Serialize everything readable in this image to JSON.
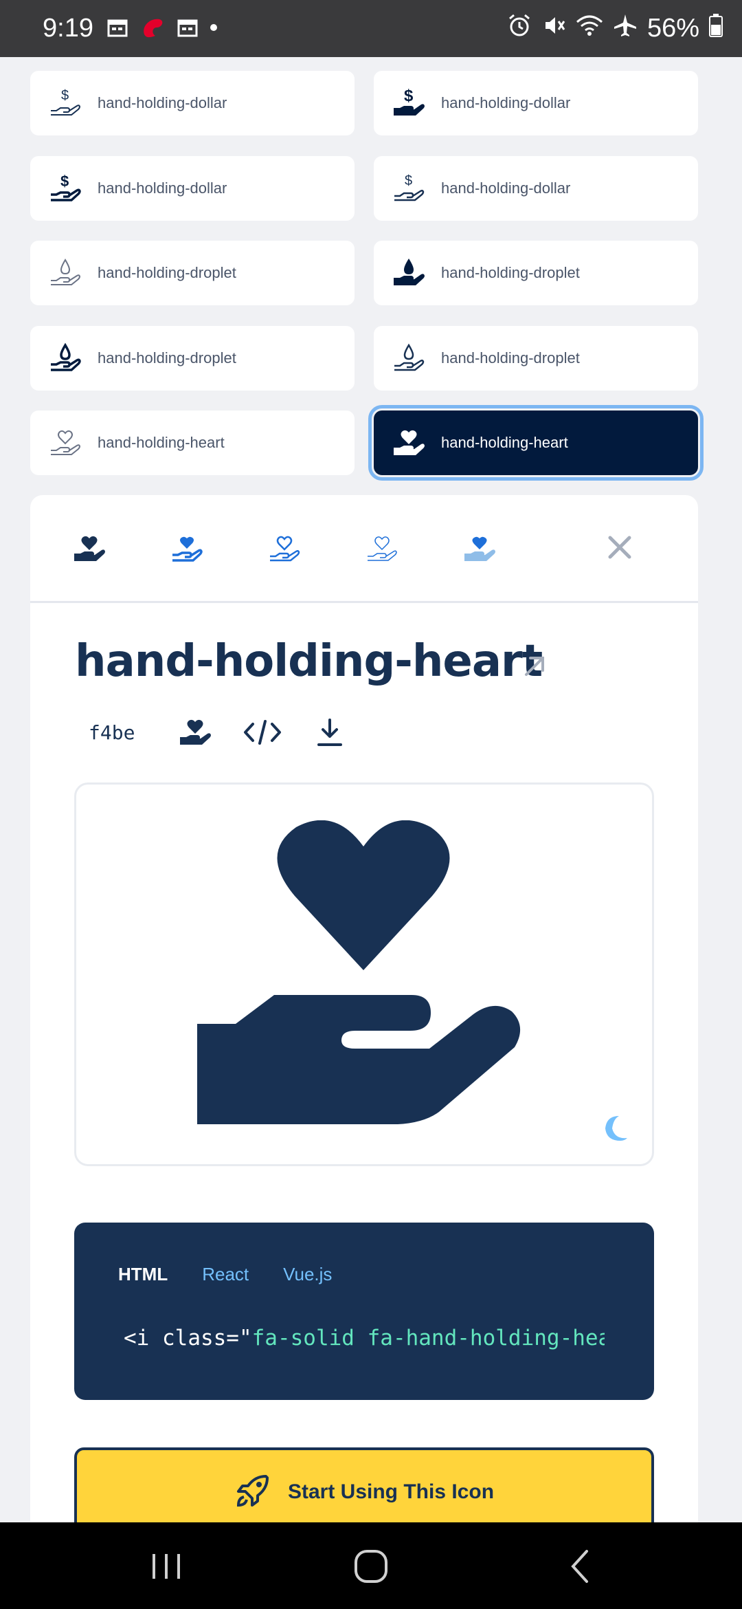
{
  "status_bar": {
    "time": "9:19",
    "battery": "56%"
  },
  "grid": {
    "items": [
      {
        "label": "hand-holding-dollar",
        "icon": "hand-holding-dollar-thin-icon"
      },
      {
        "label": "hand-holding-dollar",
        "icon": "hand-holding-dollar-solid-icon"
      },
      {
        "label": "hand-holding-dollar",
        "icon": "hand-holding-dollar-regular-icon"
      },
      {
        "label": "hand-holding-dollar",
        "icon": "hand-holding-dollar-light-icon"
      },
      {
        "label": "hand-holding-droplet",
        "icon": "hand-holding-droplet-thin-icon"
      },
      {
        "label": "hand-holding-droplet",
        "icon": "hand-holding-droplet-solid-icon"
      },
      {
        "label": "hand-holding-droplet",
        "icon": "hand-holding-droplet-regular-icon"
      },
      {
        "label": "hand-holding-droplet",
        "icon": "hand-holding-droplet-light-icon"
      },
      {
        "label": "hand-holding-heart",
        "icon": "hand-holding-heart-thin-icon"
      },
      {
        "label": "hand-holding-heart",
        "icon": "hand-holding-heart-solid-icon",
        "selected": true
      }
    ]
  },
  "detail": {
    "title": "hand-holding-heart",
    "unicode": "f4be",
    "code_tabs": [
      "HTML",
      "React",
      "Vue.js"
    ],
    "active_tab": "HTML",
    "snippet_prefix": "<i class=\"",
    "snippet_string": "fa-solid fa-hand-holding-heart",
    "cta_label": "Start Using This Icon"
  },
  "colors": {
    "navy": "#183153",
    "selected_bg": "#021a3d",
    "accent_blue": "#74c0fc",
    "cta_yellow": "#ffd43b",
    "code_string": "#63e6be"
  }
}
